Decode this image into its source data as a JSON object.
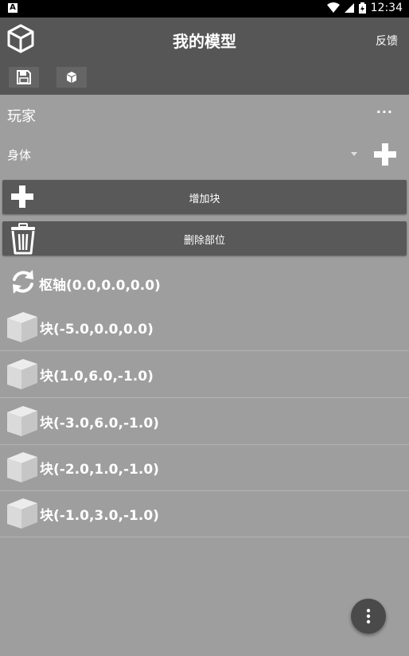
{
  "status_bar": {
    "indicator": "A",
    "time": "12:34"
  },
  "app_bar": {
    "title": "我的模型",
    "feedback_label": "反馈"
  },
  "toolbar": {
    "save_icon": "save-icon",
    "model_icon": "cube-icon"
  },
  "player": {
    "label": "玩家",
    "more_label": "···"
  },
  "part_selector": {
    "selected": "身体"
  },
  "actions": {
    "add_block_label": "增加块",
    "delete_part_label": "删除部位"
  },
  "pivot": {
    "label": "枢轴(0.0,0.0,0.0)"
  },
  "blocks": [
    {
      "label": "块(-5.0,0.0,0.0)"
    },
    {
      "label": "块(1.0,6.0,-1.0)"
    },
    {
      "label": "块(-3.0,6.0,-1.0)"
    },
    {
      "label": "块(-2.0,1.0,-1.0)"
    },
    {
      "label": "块(-1.0,3.0,-1.0)"
    }
  ],
  "colors": {
    "app_bar": "#565656",
    "background": "#9e9e9e",
    "button": "#595959"
  }
}
